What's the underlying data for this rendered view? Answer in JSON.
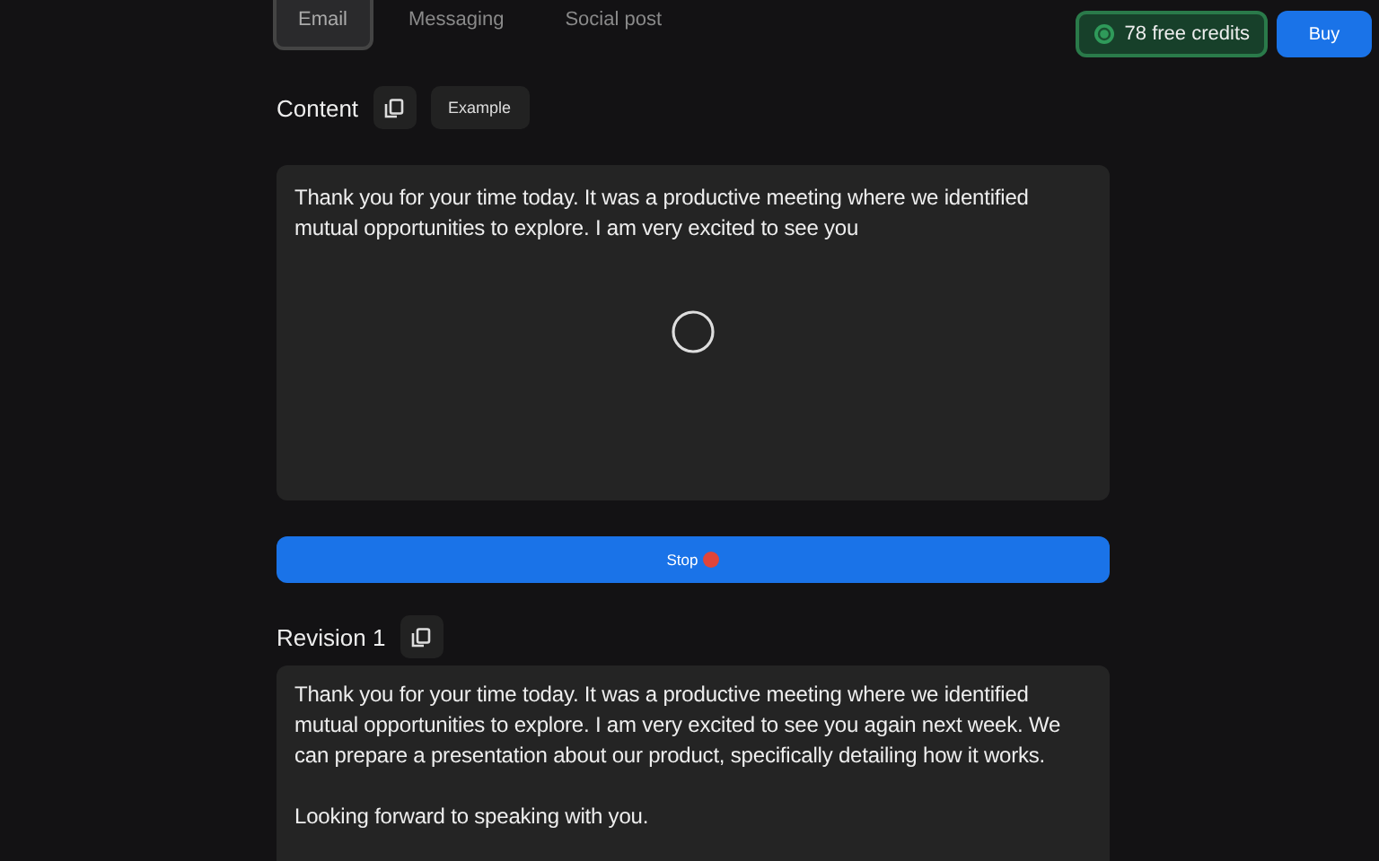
{
  "tabs": [
    {
      "label": "Email",
      "selected": true
    },
    {
      "label": "Messaging",
      "selected": false
    },
    {
      "label": "Social post",
      "selected": false
    }
  ],
  "credits": {
    "label": "78 free credits"
  },
  "buy_button": "Buy",
  "content": {
    "title": "Content",
    "example_button": "Example",
    "text": "Thank you for your time today. It was a productive meeting where we identified mutual opportunities to explore. I am very excited to see you",
    "loading": true
  },
  "stop_button": "Stop",
  "revisions": [
    {
      "title": "Revision 1",
      "paragraphs": [
        "Thank you for your time today. It was a productive meeting where we identified mutual opportunities to explore. I am very excited to see you again next week. We can prepare a presentation about our product, specifically detailing how it works.",
        "Looking forward to speaking with you."
      ]
    }
  ]
}
